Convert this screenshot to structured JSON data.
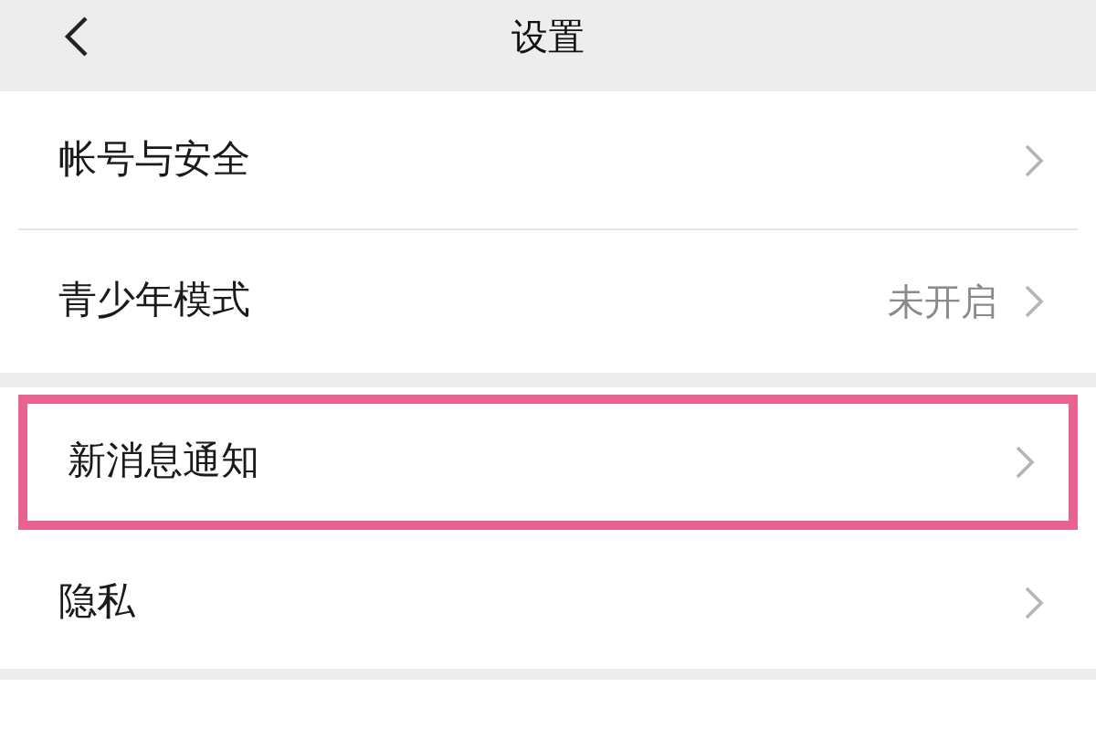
{
  "header": {
    "title": "设置"
  },
  "groups": [
    {
      "items": [
        {
          "label": "帐号与安全",
          "highlighted": false
        },
        {
          "label": "青少年模式",
          "value": "未开启",
          "highlighted": false
        }
      ]
    },
    {
      "items": [
        {
          "label": "新消息通知",
          "highlighted": true
        },
        {
          "label": "隐私",
          "highlighted": false
        }
      ]
    }
  ]
}
